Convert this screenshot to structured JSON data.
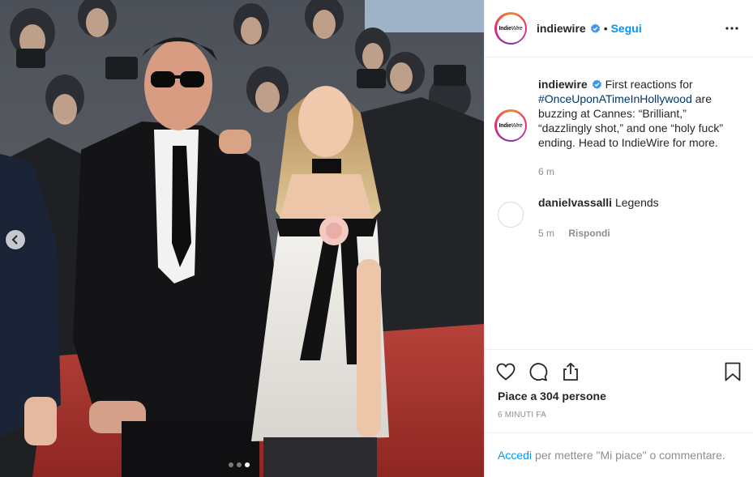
{
  "post": {
    "account": {
      "username": "indiewire",
      "logo_text": "Indie",
      "logo_text_suffix": "Wire",
      "follow_label": "Segui",
      "separator": "•"
    },
    "caption": {
      "username": "indiewire",
      "text_before": " First reactions for ",
      "hashtag": "#OnceUponATimeInHollywood",
      "text_after": " are buzzing at Cannes: “Brilliant,” “dazzlingly shot,” and one “holy fuck” ending. Head to IndieWire for more.",
      "time": "6 m"
    },
    "comments": [
      {
        "username": "danielvassalli",
        "text": " Legends",
        "time": "5 m",
        "reply_label": "Rispondi"
      }
    ],
    "likes_label": "Piace a 304 persone",
    "timestamp": "6 minuti fa",
    "login": {
      "link": "Accedi",
      "text": "per mettere \"Mi piace\" o commentare."
    },
    "carousel": {
      "slides": 3,
      "active": 3
    }
  },
  "colors": {
    "accent": "#0095f6",
    "hashtag": "#00376b",
    "muted": "#8e8e8e",
    "red_carpet": "#a3312c"
  },
  "icons": [
    "verified-badge-icon",
    "more-options-icon",
    "heart-icon",
    "comment-icon",
    "share-icon",
    "bookmark-icon",
    "chevron-left-icon"
  ]
}
